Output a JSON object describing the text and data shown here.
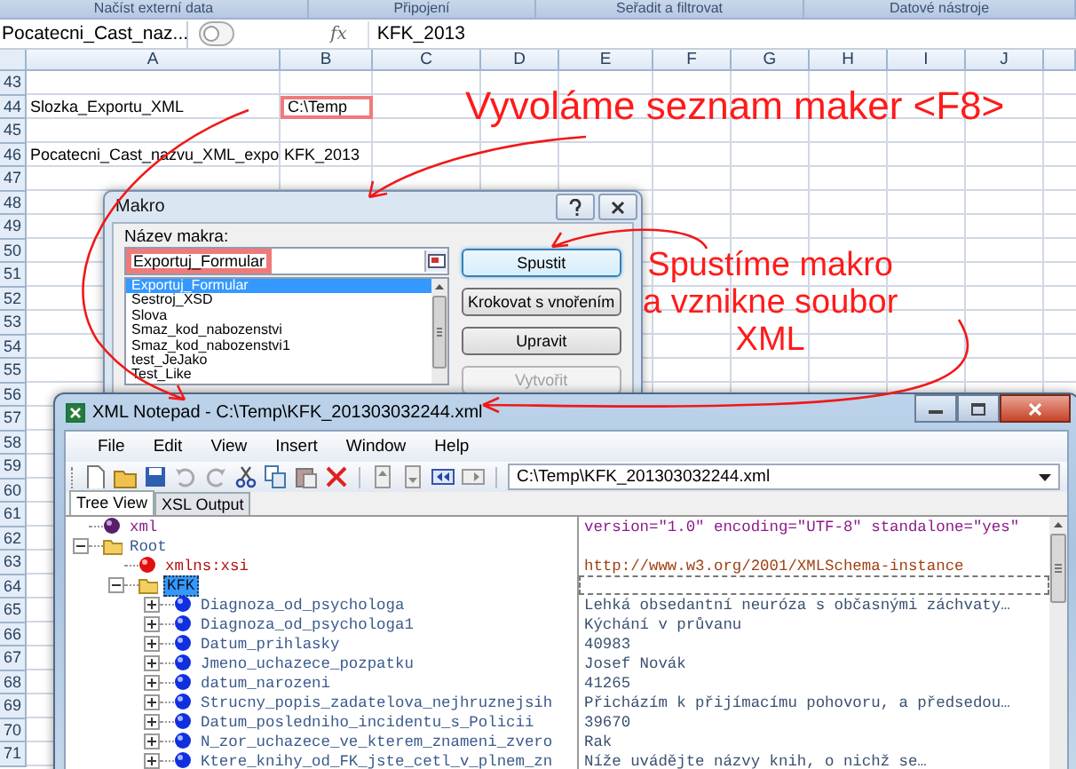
{
  "ribbon": {
    "groups": [
      "Načíst externí data",
      "Připojení",
      "Seřadit a filtrovat",
      "Datové nástroje"
    ]
  },
  "formula_bar": {
    "name_box": "Pocatecni_Cast_naz...",
    "fx": "fx",
    "formula": "KFK_2013"
  },
  "sheet": {
    "columns": [
      "A",
      "B",
      "C",
      "D",
      "E",
      "F",
      "G",
      "H",
      "I",
      "J"
    ],
    "rows": [
      {
        "number": "43"
      },
      {
        "number": "44",
        "cells": [
          {
            "text": "Slozka_Exportu_XML",
            "highlighted": false
          },
          {
            "text": "C:\\Temp",
            "highlighted": true
          }
        ]
      },
      {
        "number": "45"
      },
      {
        "number": "46",
        "cells": [
          {
            "text": "Pocatecni_Cast_nazvu_XML_expo",
            "highlighted": false
          },
          {
            "text": "KFK_2013",
            "highlighted": false
          }
        ]
      },
      {
        "number": "47"
      },
      {
        "number": "48"
      },
      {
        "number": "49"
      },
      {
        "number": "50"
      },
      {
        "number": "51"
      },
      {
        "number": "52"
      },
      {
        "number": "53"
      },
      {
        "number": "54"
      },
      {
        "number": "55"
      },
      {
        "number": "56"
      },
      {
        "number": "57"
      },
      {
        "number": "58"
      },
      {
        "number": "59"
      },
      {
        "number": "60"
      },
      {
        "number": "61"
      },
      {
        "number": "62"
      },
      {
        "number": "63"
      },
      {
        "number": "64"
      },
      {
        "number": "65"
      },
      {
        "number": "66"
      },
      {
        "number": "67"
      },
      {
        "number": "68"
      },
      {
        "number": "69"
      },
      {
        "number": "70"
      },
      {
        "number": "71"
      }
    ]
  },
  "macro_dialog": {
    "title": "Makro",
    "name_label": "Název makra:",
    "name_value": "Exportuj_Formular",
    "name_highlighted": true,
    "macros": [
      {
        "label": "Exportuj_Formular",
        "selected": true
      },
      {
        "label": "Sestroj_XSD",
        "selected": false
      },
      {
        "label": "Slova",
        "selected": false
      },
      {
        "label": "Smaz_kod_nabozenstvi",
        "selected": false
      },
      {
        "label": "Smaz_kod_nabozenstvi1",
        "selected": false
      },
      {
        "label": "test_JeJako",
        "selected": false
      },
      {
        "label": "Test_Like",
        "selected": false
      }
    ],
    "buttons": [
      {
        "label": "Spustit",
        "default": true,
        "disabled": false
      },
      {
        "label": "Krokovat s vnořením",
        "default": false,
        "disabled": false
      },
      {
        "label": "Upravit",
        "default": false,
        "disabled": false
      },
      {
        "label": "Vytvořit",
        "default": false,
        "disabled": true
      }
    ]
  },
  "annotations": [
    {
      "text": "Vyvoláme seznam maker <F8>"
    },
    {
      "text": "Spustíme makro\na vznikne soubor\nXML"
    }
  ],
  "notepad": {
    "title": "XML Notepad - C:\\Temp\\KFK_201303032244.xml",
    "menu": [
      "File",
      "Edit",
      "View",
      "Insert",
      "Window",
      "Help"
    ],
    "path": "C:\\Temp\\KFK_201303032244.xml",
    "tabs": [
      {
        "label": "Tree View",
        "selected": true
      },
      {
        "label": "XSL Output",
        "selected": false
      }
    ],
    "tree": [
      {
        "label": "xml",
        "kind": "instruction",
        "selected": false,
        "value": "version=\"1.0\" encoding=\"UTF-8\" standalone=\"yes\""
      },
      {
        "label": "Root",
        "kind": "element",
        "expanded": true,
        "selected": false,
        "children": [
          {
            "label": "xmlns:xsi",
            "kind": "attribute",
            "selected": false,
            "value": "http://www.w3.org/2001/XMLSchema-instance"
          },
          {
            "label": "KFK",
            "kind": "element",
            "expanded": true,
            "selected": true,
            "children": [
              {
                "label": "Diagnoza_od_psychologa",
                "kind": "leaf",
                "expanded": false,
                "selected": false,
                "value": "Lehká obsedantní neuróza s občasnými záchvaty…"
              },
              {
                "label": "Diagnoza_od_psychologa1",
                "kind": "leaf",
                "expanded": false,
                "selected": false,
                "value": "Kýchání v průvanu"
              },
              {
                "label": "Datum_prihlasky",
                "kind": "leaf",
                "expanded": false,
                "selected": false,
                "value": "40983"
              },
              {
                "label": "Jmeno_uchazece_pozpatku",
                "kind": "leaf",
                "expanded": false,
                "selected": false,
                "value": "Josef Novák"
              },
              {
                "label": "datum_narozeni",
                "kind": "leaf",
                "expanded": false,
                "selected": false,
                "value": "41265"
              },
              {
                "label": "Strucny_popis_zadatelova_nejhruznejsih",
                "kind": "leaf",
                "expanded": false,
                "selected": false,
                "value": "Přicházím k přijímacímu pohovoru, a předsedou…"
              },
              {
                "label": "Datum_posledniho_incidentu_s_Policii",
                "kind": "leaf",
                "expanded": false,
                "selected": false,
                "value": "39670"
              },
              {
                "label": "N_zor_uchazece_ve_kterem_znameni_zvero",
                "kind": "leaf",
                "expanded": false,
                "selected": false,
                "value": "Rak"
              },
              {
                "label": "Ktere_knihy_od_FK_jste_cetl_v_plnem_zn",
                "kind": "leaf",
                "expanded": false,
                "selected": false,
                "value": "Níže uvádějte názvy knih, o nichž se…"
              }
            ]
          }
        ]
      }
    ]
  }
}
